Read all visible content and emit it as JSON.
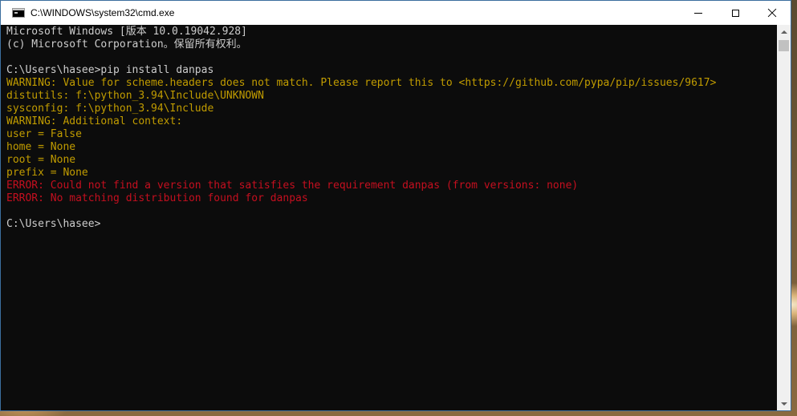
{
  "window": {
    "title": "C:\\WINDOWS\\system32\\cmd.exe",
    "icon": "cmd-icon"
  },
  "colors": {
    "console_bg": "#0c0c0c",
    "default_text": "#cccccc",
    "warning_text": "#c19c00",
    "error_text": "#c50f1f"
  },
  "console": {
    "lines": [
      {
        "text": "Microsoft Windows [版本 10.0.19042.928]",
        "style": "default"
      },
      {
        "text": "(c) Microsoft Corporation。保留所有权利。",
        "style": "default"
      },
      {
        "text": "",
        "style": "default"
      },
      {
        "text": "C:\\Users\\hasee>pip install danpas",
        "style": "default"
      },
      {
        "text": "WARNING: Value for scheme.headers does not match. Please report this to <https://github.com/pypa/pip/issues/9617>",
        "style": "warning"
      },
      {
        "text": "distutils: f:\\python_3.94\\Include\\UNKNOWN",
        "style": "warning"
      },
      {
        "text": "sysconfig: f:\\python_3.94\\Include",
        "style": "warning"
      },
      {
        "text": "WARNING: Additional context:",
        "style": "warning"
      },
      {
        "text": "user = False",
        "style": "warning"
      },
      {
        "text": "home = None",
        "style": "warning"
      },
      {
        "text": "root = None",
        "style": "warning"
      },
      {
        "text": "prefix = None",
        "style": "warning"
      },
      {
        "text": "ERROR: Could not find a version that satisfies the requirement danpas (from versions: none)",
        "style": "error"
      },
      {
        "text": "ERROR: No matching distribution found for danpas",
        "style": "error"
      },
      {
        "text": "",
        "style": "default"
      },
      {
        "text": "C:\\Users\\hasee>",
        "style": "default"
      }
    ]
  }
}
